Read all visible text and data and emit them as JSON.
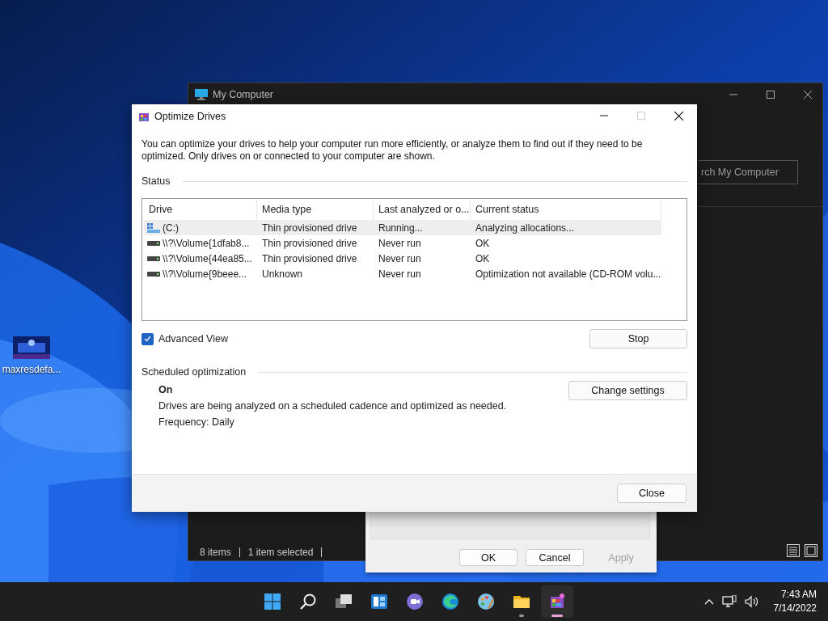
{
  "desktop": {
    "icons": [
      {
        "label": "maxresdefa..."
      }
    ]
  },
  "explorer_window": {
    "title": "My Computer",
    "search": {
      "placeholder": "rch My Computer"
    },
    "status_bar": [
      "8 items",
      "1 item selected"
    ]
  },
  "properties_dialog": {
    "buttons": [
      {
        "label": "OK",
        "disabled": false
      },
      {
        "label": "Cancel",
        "disabled": false
      },
      {
        "label": "Apply",
        "disabled": true
      }
    ]
  },
  "dialog": {
    "title": "Optimize Drives",
    "description": "You can optimize your drives to help your computer run more efficiently, or analyze them to find out if they need to be optimized. Only drives on or connected to your computer are shown.",
    "status_heading": "Status",
    "table": {
      "columns": [
        "Drive",
        "Media type",
        "Last analyzed or o...",
        "Current status"
      ],
      "rows": [
        {
          "kind": "system",
          "selected": true,
          "cells": [
            "(C:)",
            "Thin provisioned drive",
            "Running...",
            "Analyzing allocations..."
          ]
        },
        {
          "kind": "volume",
          "selected": false,
          "cells": [
            "\\\\?\\Volume{1dfab8...",
            "Thin provisioned drive",
            "Never run",
            "OK"
          ]
        },
        {
          "kind": "volume",
          "selected": false,
          "cells": [
            "\\\\?\\Volume{44ea85...",
            "Thin provisioned drive",
            "Never run",
            "OK"
          ]
        },
        {
          "kind": "volume",
          "selected": false,
          "cells": [
            "\\\\?\\Volume{9beee...",
            "Unknown",
            "Never run",
            "Optimization not available (CD-ROM volu..."
          ]
        }
      ]
    },
    "advanced_view": {
      "label": "Advanced View",
      "checked": true
    },
    "stop_button": "Stop",
    "scheduled": {
      "heading": "Scheduled optimization",
      "state": "On",
      "description": "Drives are being analyzed on a scheduled cadence and optimized as needed.",
      "frequency": "Frequency: Daily",
      "button": "Change settings"
    },
    "close_button": "Close"
  },
  "taskbar": {
    "apps": [
      {
        "kind": "start",
        "running": false,
        "selected": false
      },
      {
        "kind": "search",
        "running": false,
        "selected": false
      },
      {
        "kind": "taskview",
        "running": false,
        "selected": false
      },
      {
        "kind": "widgets",
        "running": false,
        "selected": false
      },
      {
        "kind": "chat",
        "running": false,
        "selected": false
      },
      {
        "kind": "edge",
        "running": false,
        "selected": false
      },
      {
        "kind": "paint",
        "running": false,
        "selected": false
      },
      {
        "kind": "explorer",
        "running": true,
        "selected": false
      },
      {
        "kind": "defrag",
        "running": true,
        "selected": true
      }
    ],
    "clock": {
      "time": "7:43 AM",
      "date": "7/14/2022"
    }
  }
}
